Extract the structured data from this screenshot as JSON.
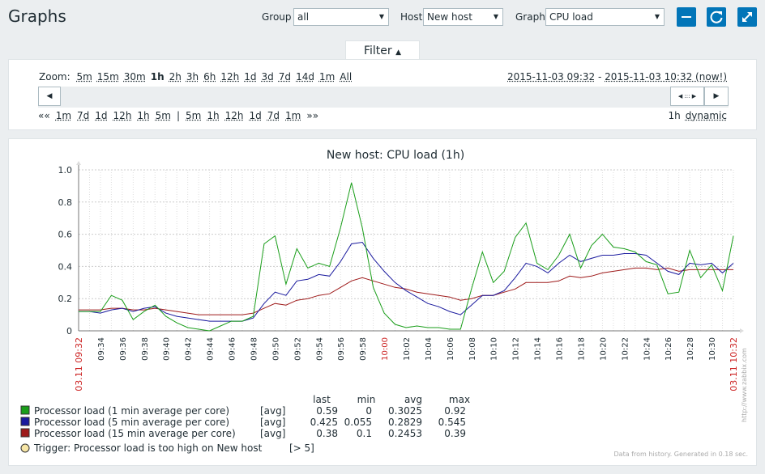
{
  "page": {
    "title": "Graphs"
  },
  "controls": {
    "group_label": "Group",
    "group_value": "all",
    "host_label": "Host",
    "host_value": "New host",
    "graph_label": "Graph",
    "graph_value": "CPU load"
  },
  "icons": {
    "minimize": "minus-icon",
    "refresh": "refresh-icon",
    "fullscreen": "fullscreen-icon",
    "accent": "#0275b8"
  },
  "filter": {
    "tab_label": "Filter",
    "zoom_label": "Zoom:",
    "zoom_options": [
      "5m",
      "15m",
      "30m",
      "1h",
      "2h",
      "3h",
      "6h",
      "12h",
      "1d",
      "3d",
      "7d",
      "14d",
      "1m",
      "All"
    ],
    "zoom_selected": "1h",
    "range_start": "2015-11-03 09:32",
    "range_sep": " - ",
    "range_end": "2015-11-03 10:32 (now!)",
    "nav_back_all": "««",
    "nav_back": [
      "1m",
      "7d",
      "1d",
      "12h",
      "1h",
      "5m"
    ],
    "nav_sep": "|",
    "nav_fwd": [
      "5m",
      "1h",
      "12h",
      "1d",
      "7d",
      "1m"
    ],
    "nav_fwd_all": "»»",
    "period_value": "1h",
    "period_mode": "dynamic"
  },
  "chart_data": {
    "type": "line",
    "title": "New host: CPU load (1h)",
    "ylim": [
      0,
      1
    ],
    "yticks": [
      "0",
      "0.2",
      "0.4",
      "0.6",
      "0.8",
      "1.0"
    ],
    "x_start_label": "03.11 09:32",
    "x_end_label": "03.11 10:32",
    "x_ticks": [
      "09:34",
      "09:36",
      "09:38",
      "09:40",
      "09:42",
      "09:44",
      "09:46",
      "09:48",
      "09:50",
      "09:52",
      "09:54",
      "09:56",
      "09:58",
      "10:00",
      "10:02",
      "10:04",
      "10:06",
      "10:08",
      "10:10",
      "10:12",
      "10:14",
      "10:16",
      "10:18",
      "10:20",
      "10:22",
      "10:24",
      "10:26",
      "10:28",
      "10:30"
    ],
    "highlight_tick": "10:00",
    "x_minutes": [
      0,
      1,
      2,
      3,
      4,
      5,
      6,
      7,
      8,
      9,
      10,
      11,
      12,
      13,
      14,
      15,
      16,
      17,
      18,
      19,
      20,
      21,
      22,
      23,
      24,
      25,
      26,
      27,
      28,
      29,
      30,
      31,
      32,
      33,
      34,
      35,
      36,
      37,
      38,
      39,
      40,
      41,
      42,
      43,
      44,
      45,
      46,
      47,
      48,
      49,
      50,
      51,
      52,
      53,
      54,
      55,
      56,
      57,
      58,
      59,
      60
    ],
    "series": [
      {
        "name": "Processor load (1 min average per core)",
        "color": "#1a9e1a",
        "values": [
          0.12,
          0.12,
          0.12,
          0.22,
          0.19,
          0.07,
          0.12,
          0.16,
          0.09,
          0.05,
          0.02,
          0.01,
          0.0,
          0.03,
          0.06,
          0.06,
          0.09,
          0.54,
          0.59,
          0.29,
          0.51,
          0.39,
          0.42,
          0.4,
          0.64,
          0.92,
          0.64,
          0.27,
          0.11,
          0.04,
          0.02,
          0.03,
          0.02,
          0.02,
          0.01,
          0.01,
          0.26,
          0.49,
          0.3,
          0.37,
          0.58,
          0.67,
          0.42,
          0.38,
          0.47,
          0.6,
          0.39,
          0.53,
          0.6,
          0.52,
          0.51,
          0.49,
          0.43,
          0.41,
          0.23,
          0.24,
          0.5,
          0.33,
          0.41,
          0.25,
          0.59
        ]
      },
      {
        "name": "Processor load (5 min average per core)",
        "color": "#1a1a9e",
        "values": [
          0.12,
          0.12,
          0.11,
          0.13,
          0.14,
          0.12,
          0.14,
          0.15,
          0.11,
          0.09,
          0.08,
          0.07,
          0.06,
          0.06,
          0.06,
          0.06,
          0.08,
          0.17,
          0.24,
          0.22,
          0.31,
          0.32,
          0.35,
          0.34,
          0.43,
          0.54,
          0.55,
          0.45,
          0.37,
          0.3,
          0.25,
          0.21,
          0.17,
          0.15,
          0.12,
          0.1,
          0.16,
          0.22,
          0.22,
          0.25,
          0.33,
          0.42,
          0.4,
          0.36,
          0.42,
          0.47,
          0.43,
          0.45,
          0.47,
          0.47,
          0.48,
          0.48,
          0.47,
          0.42,
          0.37,
          0.35,
          0.42,
          0.41,
          0.42,
          0.36,
          0.42
        ]
      },
      {
        "name": "Processor load (15 min average per core)",
        "color": "#9e1a1a",
        "values": [
          0.13,
          0.13,
          0.13,
          0.14,
          0.14,
          0.13,
          0.13,
          0.14,
          0.13,
          0.12,
          0.11,
          0.1,
          0.1,
          0.1,
          0.1,
          0.1,
          0.11,
          0.14,
          0.17,
          0.16,
          0.19,
          0.2,
          0.22,
          0.23,
          0.27,
          0.31,
          0.33,
          0.31,
          0.29,
          0.27,
          0.26,
          0.24,
          0.23,
          0.22,
          0.21,
          0.19,
          0.2,
          0.22,
          0.22,
          0.24,
          0.26,
          0.3,
          0.3,
          0.3,
          0.31,
          0.34,
          0.33,
          0.34,
          0.36,
          0.37,
          0.38,
          0.39,
          0.39,
          0.38,
          0.39,
          0.37,
          0.38,
          0.38,
          0.38,
          0.38,
          0.38
        ]
      }
    ],
    "legend_headers": [
      "last",
      "min",
      "avg",
      "max"
    ],
    "legend_rows": [
      {
        "name": "Processor load (1 min average per core)",
        "func": "[avg]",
        "last": "0.59",
        "min": "0",
        "avg": "0.3025",
        "max": "0.92",
        "color": "#1a9e1a"
      },
      {
        "name": "Processor load (5 min average per core)",
        "func": "[avg]",
        "last": "0.425",
        "min": "0.055",
        "avg": "0.2829",
        "max": "0.545",
        "color": "#1a1a9e"
      },
      {
        "name": "Processor load (15 min average per core)",
        "func": "[avg]",
        "last": "0.38",
        "min": "0.1",
        "avg": "0.2453",
        "max": "0.39",
        "color": "#9e1a1a"
      }
    ],
    "trigger": {
      "text": "Trigger: Processor load is too high on New host",
      "value": "[> 5]",
      "color": "#f7e6a6"
    },
    "footer_note": "Data from history. Generated in 0.18 sec.",
    "watermark": "http://www.zabbix.com"
  }
}
